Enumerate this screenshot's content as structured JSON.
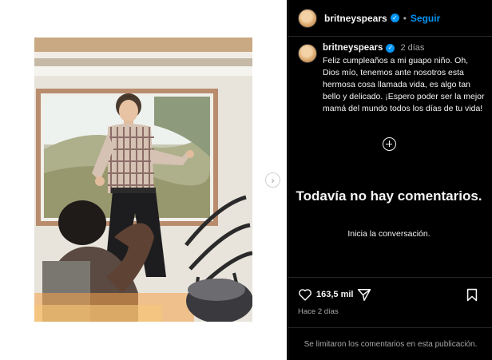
{
  "post": {
    "username": "britneyspears",
    "follow_label": "Seguir",
    "separator": "•",
    "verified_mark": "✓",
    "time_ago": "2 días",
    "caption": "Feliz cumpleaños a mi guapo niño. Oh, Dios mío, tenemos ante nosotros esta hermosa cosa llamada vida, es algo tan bello y delicado. ¡Espero poder ser la mejor mamá del mundo todos los días de tu vida!",
    "empty_title": "Todavía no hay comentarios.",
    "empty_subtitle": "Inicia la conversación.",
    "likes": "163,5 mil",
    "posted_ago": "Hace 2 días",
    "comments_limited": "Se limitaron los comentarios en esta publicación."
  },
  "carousel": {
    "next_glyph": "›"
  },
  "icons": {
    "avatar": "avatar-photo",
    "add": "plus-circle-icon",
    "like": "heart-icon",
    "share": "send-icon",
    "save": "bookmark-icon",
    "next": "chevron-right-icon"
  },
  "colors": {
    "accent": "#0095f6",
    "background": "#000000",
    "text": "#f5f5f5",
    "muted": "#a8a8a8",
    "divider": "#262626"
  }
}
